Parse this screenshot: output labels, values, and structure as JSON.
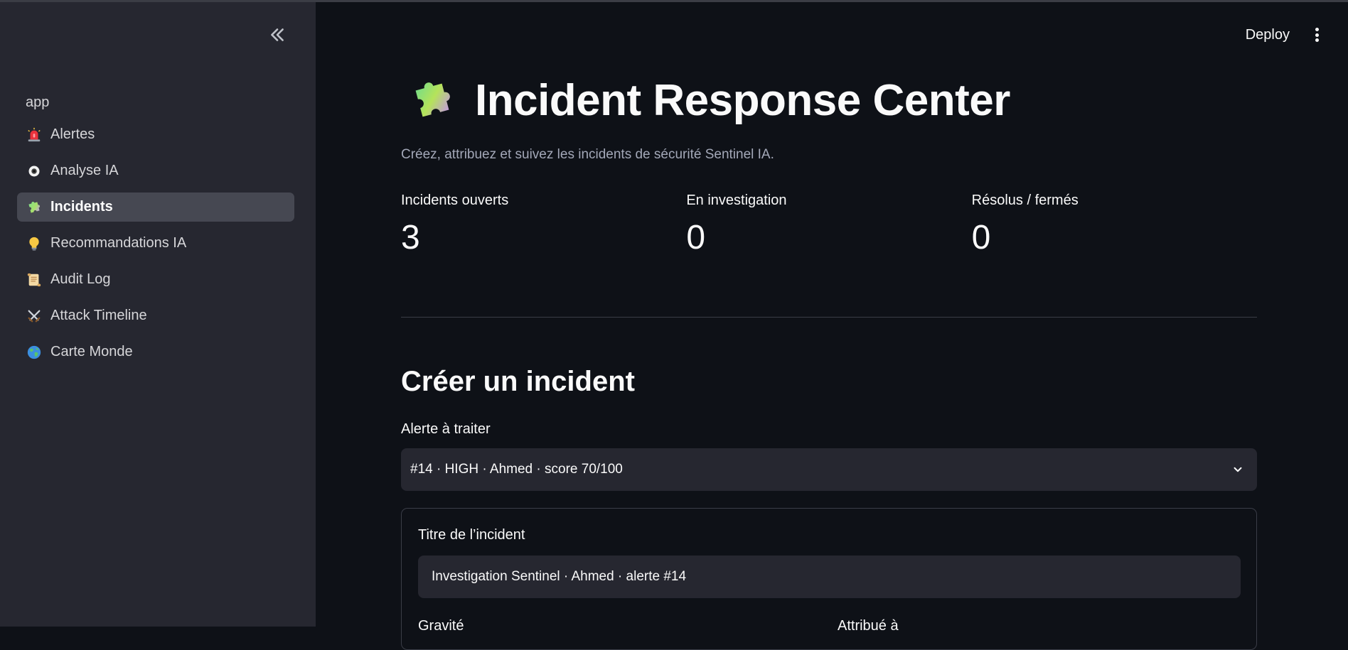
{
  "sidebar": {
    "app_label": "app",
    "items": [
      {
        "label": "Alertes",
        "icon": "rotating-light-icon"
      },
      {
        "label": "Analyse IA",
        "icon": "eye-icon"
      },
      {
        "label": "Incidents",
        "icon": "puzzle-piece-icon",
        "active": true
      },
      {
        "label": "Recommandations IA",
        "icon": "light-bulb-icon"
      },
      {
        "label": "Audit Log",
        "icon": "scroll-icon"
      },
      {
        "label": "Attack Timeline",
        "icon": "crossed-swords-icon"
      },
      {
        "label": "Carte Monde",
        "icon": "globe-icon"
      }
    ]
  },
  "header": {
    "deploy_label": "Deploy"
  },
  "page": {
    "title": "Incident Response Center",
    "title_icon": "puzzle-piece-icon",
    "subtitle": "Créez, attribuez et suivez les incidents de sécurité Sentinel IA."
  },
  "metrics": [
    {
      "label": "Incidents ouverts",
      "value": "3"
    },
    {
      "label": "En investigation",
      "value": "0"
    },
    {
      "label": "Résolus / fermés",
      "value": "0"
    }
  ],
  "create_incident": {
    "title": "Créer un incident",
    "alert_label": "Alerte à traiter",
    "alert_selected": "#14 · HIGH · Ahmed · score 70/100",
    "incident_title_label": "Titre de l’incident",
    "incident_title_value": "Investigation Sentinel · Ahmed · alerte #14",
    "severity_label": "Gravité",
    "assigned_label": "Attribué à"
  },
  "colors": {
    "background": "#0e1117",
    "sidebar": "#262730",
    "active_nav": "#464852",
    "input_bg": "#262730",
    "muted_text": "#a3a8b8"
  }
}
